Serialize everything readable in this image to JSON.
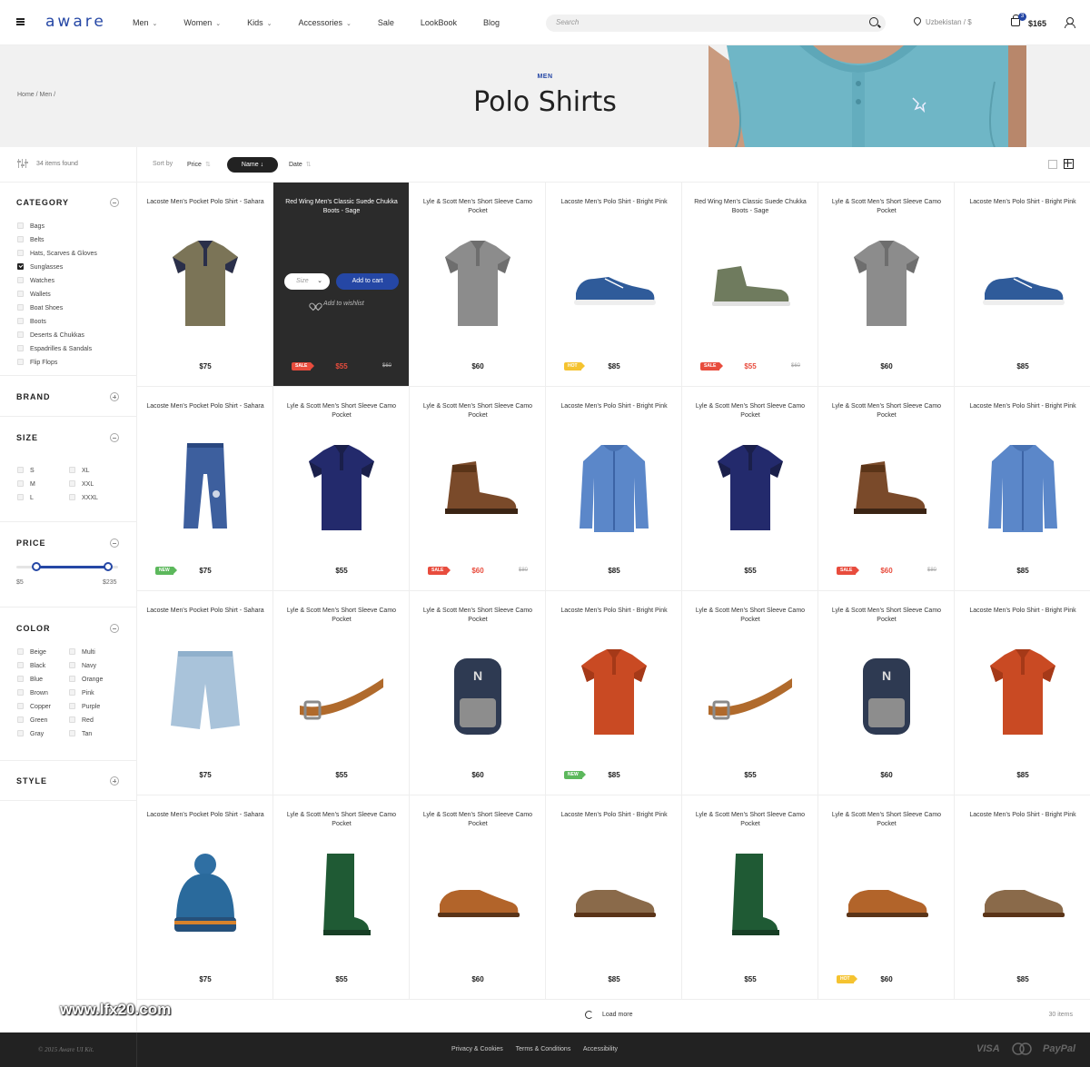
{
  "header": {
    "logo": "aware",
    "nav": [
      {
        "label": "Men",
        "has_menu": true
      },
      {
        "label": "Women",
        "has_menu": true
      },
      {
        "label": "Kids",
        "has_menu": true
      },
      {
        "label": "Accessories",
        "has_menu": true
      },
      {
        "label": "Sale",
        "has_menu": false
      },
      {
        "label": "LookBook",
        "has_menu": false
      },
      {
        "label": "Blog",
        "has_menu": false
      }
    ],
    "search_placeholder": "Search",
    "location": "Uzbekistan / $",
    "cart_count": "3",
    "cart_total": "$165"
  },
  "hero": {
    "breadcrumb": "Home / Men /",
    "eyebrow": "MEN",
    "title": "Polo Shirts"
  },
  "toolbar": {
    "items_found": "34 items found",
    "sort_by": "Sort by",
    "sort_price": "Price",
    "sort_name": "Name",
    "sort_date": "Date"
  },
  "filters": {
    "category": {
      "title": "CATEGORY",
      "options": [
        {
          "label": "Bags",
          "checked": false
        },
        {
          "label": "Belts",
          "checked": false
        },
        {
          "label": "Hats, Scarves & Gloves",
          "checked": false
        },
        {
          "label": "Sunglasses",
          "checked": true
        },
        {
          "label": "Watches",
          "checked": false
        },
        {
          "label": "Wallets",
          "checked": false
        },
        {
          "label": "Boat Shoes",
          "checked": false
        },
        {
          "label": "Boots",
          "checked": false
        },
        {
          "label": "Deserts & Chukkas",
          "checked": false
        },
        {
          "label": "Espadrilles & Sandals",
          "checked": false
        },
        {
          "label": "Flip Flops",
          "checked": false
        }
      ]
    },
    "brand": {
      "title": "BRAND"
    },
    "size": {
      "title": "SIZE",
      "options": [
        "S",
        "M",
        "L",
        "XL",
        "XXL",
        "XXXL"
      ]
    },
    "price": {
      "title": "PRICE",
      "min": "$5",
      "max": "$235",
      "range_fraction": [
        0.2,
        0.9
      ]
    },
    "color": {
      "title": "COLOR",
      "options": [
        "Beige",
        "Black",
        "Blue",
        "Brown",
        "Copper",
        "Green",
        "Gray",
        "Multi",
        "Navy",
        "Orange",
        "Pink",
        "Purple",
        "Red",
        "Tan"
      ]
    },
    "style": {
      "title": "STYLE"
    }
  },
  "hover_card": {
    "size_label": "Size",
    "add_to_cart": "Add to cart",
    "wishlist": "Add to wishlist"
  },
  "products": [
    {
      "name": "Lacoste Men's Pocket Polo Shirt - Sahara",
      "price": "$75",
      "img": "polo-olive"
    },
    {
      "name": "Red Wing Men's Classic Suede Chukka Boots - Sage",
      "price": "$55",
      "old": "$60",
      "tag": "SALE",
      "img": "hover",
      "dark": true
    },
    {
      "name": "Lyle & Scott Men's Short Sleeve Camo Pocket",
      "price": "$60",
      "img": "polo-gray"
    },
    {
      "name": "Lacoste Men's Polo Shirt - Bright Pink",
      "price": "$85",
      "tag": "HOT",
      "img": "sneaker"
    },
    {
      "name": "Red Wing Men's Classic Suede Chukka Boots - Sage",
      "price": "$55",
      "old": "$60",
      "tag": "SALE",
      "img": "chukka"
    },
    {
      "name": "Lyle & Scott Men's Short Sleeve Camo Pocket",
      "price": "$60",
      "img": "polo-gray"
    },
    {
      "name": "Lacoste Men's Polo Shirt - Bright Pink",
      "price": "$85",
      "img": "sneaker"
    },
    {
      "name": "Lacoste Men's Pocket Polo Shirt - Sahara",
      "price": "$75",
      "tag": "NEW",
      "img": "pants"
    },
    {
      "name": "Lyle & Scott Men's Short Sleeve Camo Pocket",
      "price": "$55",
      "img": "polo-navy"
    },
    {
      "name": "Lyle & Scott Men's Short Sleeve Camo Pocket",
      "price": "$60",
      "old": "$80",
      "tag": "SALE",
      "img": "boot"
    },
    {
      "name": "Lacoste Men's Polo Shirt - Bright Pink",
      "price": "$85",
      "img": "jacket"
    },
    {
      "name": "Lyle & Scott Men's Short Sleeve Camo Pocket",
      "price": "$55",
      "img": "polo-navy"
    },
    {
      "name": "Lyle & Scott Men's Short Sleeve Camo Pocket",
      "price": "$60",
      "old": "$80",
      "tag": "SALE",
      "img": "boot"
    },
    {
      "name": "Lacoste Men's Polo Shirt - Bright Pink",
      "price": "$85",
      "img": "jacket"
    },
    {
      "name": "Lacoste Men's Pocket Polo Shirt - Sahara",
      "price": "$75",
      "img": "shorts"
    },
    {
      "name": "Lyle & Scott Men's Short Sleeve Camo Pocket",
      "price": "$55",
      "img": "belt"
    },
    {
      "name": "Lyle & Scott Men's Short Sleeve Camo Pocket",
      "price": "$60",
      "img": "backpack"
    },
    {
      "name": "Lacoste Men's Polo Shirt - Bright Pink",
      "price": "$85",
      "tag": "NEW",
      "img": "polo-orange"
    },
    {
      "name": "Lyle & Scott Men's Short Sleeve Camo Pocket",
      "price": "$55",
      "img": "belt"
    },
    {
      "name": "Lyle & Scott Men's Short Sleeve Camo Pocket",
      "price": "$60",
      "img": "backpack"
    },
    {
      "name": "Lacoste Men's Polo Shirt - Bright Pink",
      "price": "$85",
      "img": "polo-orange"
    },
    {
      "name": "Lacoste Men's Pocket Polo Shirt - Sahara",
      "price": "$75",
      "img": "beanie"
    },
    {
      "name": "Lyle & Scott Men's Short Sleeve Camo Pocket",
      "price": "$55",
      "img": "wellies"
    },
    {
      "name": "Lyle & Scott Men's Short Sleeve Camo Pocket",
      "price": "$60",
      "img": "oxford-tan"
    },
    {
      "name": "Lacoste Men's Polo Shirt - Bright Pink",
      "price": "$85",
      "img": "oxford-brown"
    },
    {
      "name": "Lyle & Scott Men's Short Sleeve Camo Pocket",
      "price": "$55",
      "img": "wellies"
    },
    {
      "name": "Lyle & Scott Men's Short Sleeve Camo Pocket",
      "price": "$60",
      "tag": "HOT",
      "img": "oxford-tan"
    },
    {
      "name": "Lacoste Men's Polo Shirt - Bright Pink",
      "price": "$85",
      "img": "oxford-brown"
    }
  ],
  "load_more": "Load more",
  "items_total": "30 items",
  "footer": {
    "copyright": "© 2015 Aware UI Kit.",
    "links": [
      "Privacy & Cookies",
      "Terms & Conditions",
      "Accessibility"
    ],
    "payments": [
      "VISA",
      "Mastercard",
      "PayPal"
    ]
  },
  "watermark": "www.lfx20.com",
  "colors": {
    "accent": "#2547a5",
    "sale": "#e84c3d",
    "new": "#5cb85c",
    "hot": "#f5c330",
    "dark": "#222222"
  }
}
